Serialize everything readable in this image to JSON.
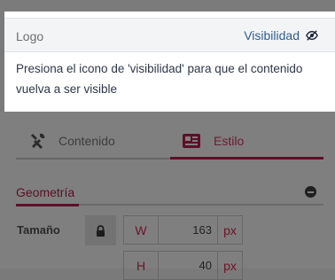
{
  "popup": {
    "title": "Logo",
    "visibility_label": "Visibilidad",
    "message": "Presiona el icono de 'visibilidad' para que el contenido vuelva a ser visible"
  },
  "panel": {
    "tabs": [
      {
        "label": "Contenido",
        "icon": "tools-icon",
        "active": false
      },
      {
        "label": "Estilo",
        "icon": "style-card-icon",
        "active": true
      }
    ],
    "section_title": "Geometría",
    "size_label": "Tamaño",
    "width": {
      "prefix": "W",
      "value": "163",
      "unit": "px"
    },
    "height": {
      "prefix": "H",
      "value": "40",
      "unit": "px"
    }
  },
  "colors": {
    "accent": "#5e0f28",
    "link": "#2e5d8f"
  }
}
